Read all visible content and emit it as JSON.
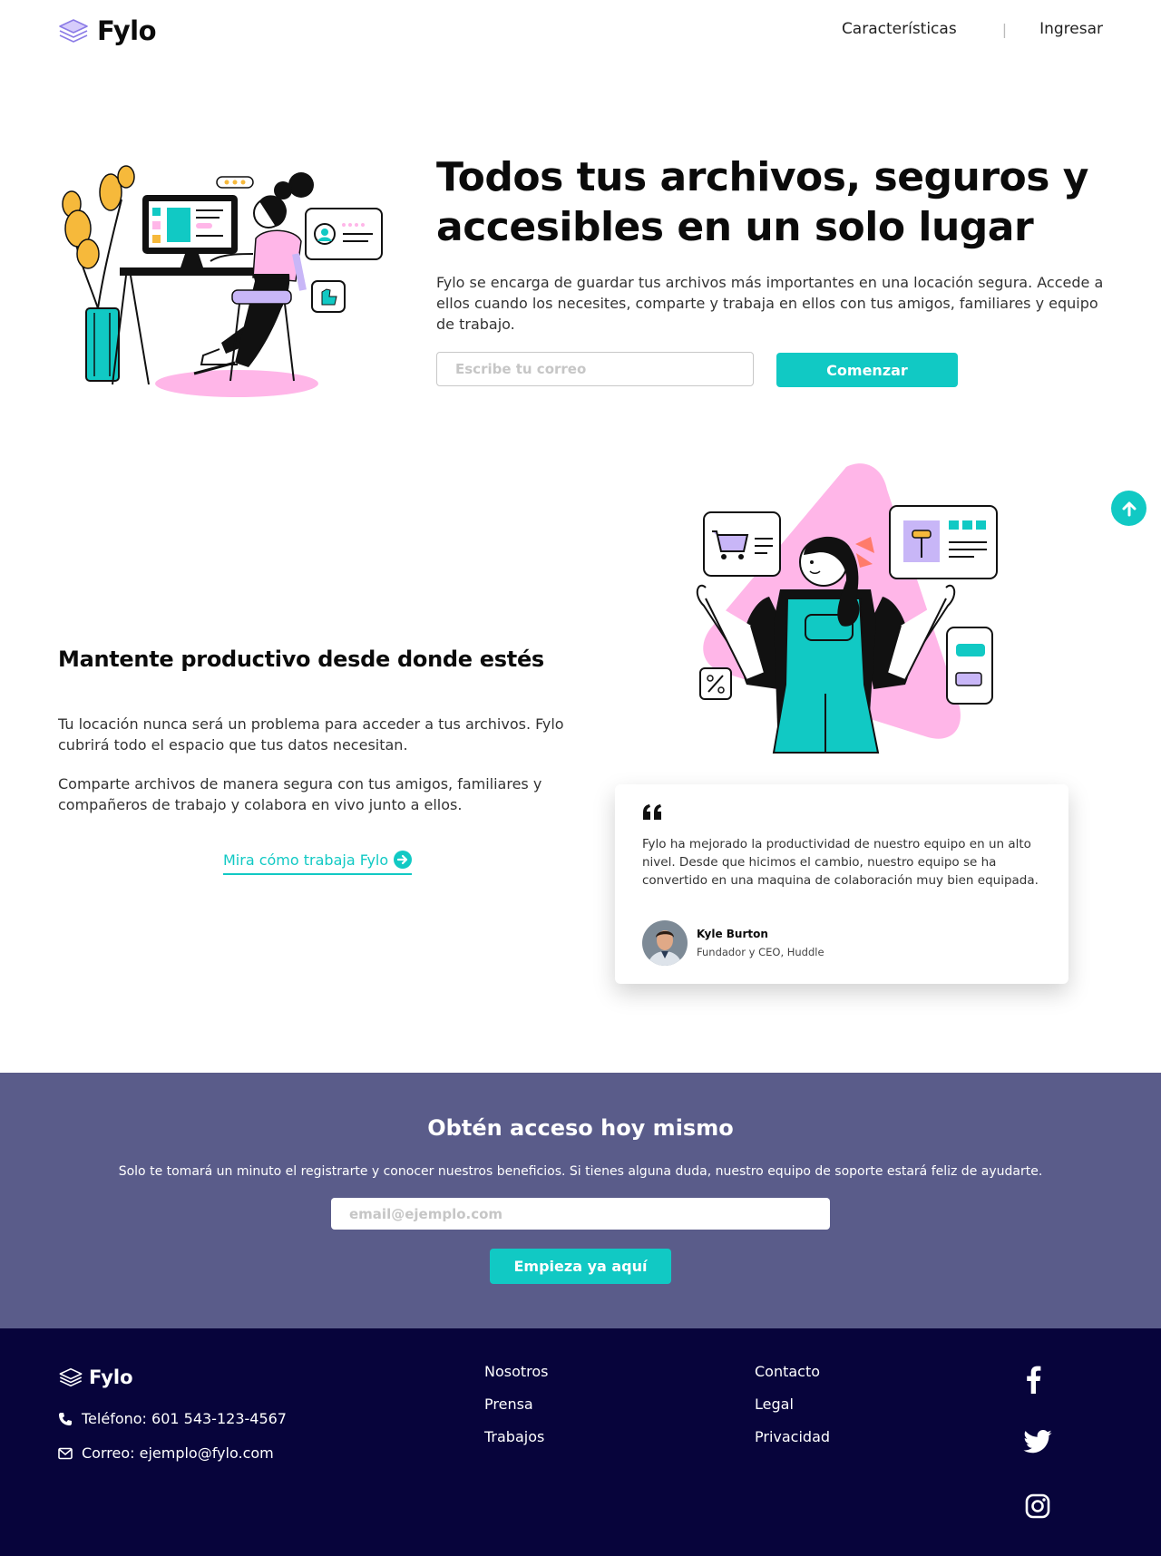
{
  "header": {
    "logo": "Fylo",
    "nav": {
      "features": "Características",
      "separator": "|",
      "login": "Ingresar"
    }
  },
  "hero": {
    "title": "Todos tus archivos, seguros y accesibles en un solo lugar",
    "text": "Fylo se encarga de guardar tus archivos más importantes en una locación segura. Accede a ellos cuando los necesites, comparte y trabaja en ellos con tus amigos, familiares y equipo de trabajo.",
    "email_placeholder": "Escribe tu correo",
    "cta": "Comenzar"
  },
  "productive": {
    "title": "Mantente productivo desde donde estés",
    "p1": "Tu locación nunca será un problema para acceder a tus archivos. Fylo cubrirá todo el espacio que tus datos necesitan.",
    "p2": "Comparte archivos de manera segura con tus amigos, familiares y compañeros de trabajo y colabora en vivo junto a ellos.",
    "link": "Mira cómo trabaja Fylo"
  },
  "testimonial": {
    "text": "Fylo ha mejorado la productividad de nuestro equipo en un alto nivel. Desde que hicimos el cambio, nuestro equipo se ha convertido en una maquina de colaboración muy bien equipada.",
    "name": "Kyle Burton",
    "role": "Fundador y CEO, Huddle"
  },
  "cta": {
    "title": "Obtén acceso hoy mismo",
    "text": "Solo te tomará un minuto el registrarte y conocer nuestros beneficios. Si tienes alguna duda, nuestro equipo de soporte estará feliz de ayudarte.",
    "email_placeholder": "email@ejemplo.com",
    "button": "Empieza ya aquí"
  },
  "footer": {
    "logo": "Fylo",
    "phone": "Teléfono: 601 543-123-4567",
    "email": "Correo: ejemplo@fylo.com",
    "col1": [
      "Nosotros",
      "Prensa",
      "Trabajos"
    ],
    "col2": [
      "Contacto",
      "Legal",
      "Privacidad"
    ]
  },
  "colors": {
    "accent": "#11c9c4",
    "cta_bg": "#5a5c8a",
    "footer_bg": "#07043b",
    "pink": "#ffb6e8",
    "yellow": "#f6b93b",
    "lavender": "#c8b6f7"
  },
  "icons": [
    "layers-logo-icon",
    "arrow-up-icon",
    "arrow-right-circle-icon",
    "quote-icon",
    "phone-icon",
    "mail-icon",
    "facebook-icon",
    "twitter-icon",
    "instagram-icon"
  ]
}
